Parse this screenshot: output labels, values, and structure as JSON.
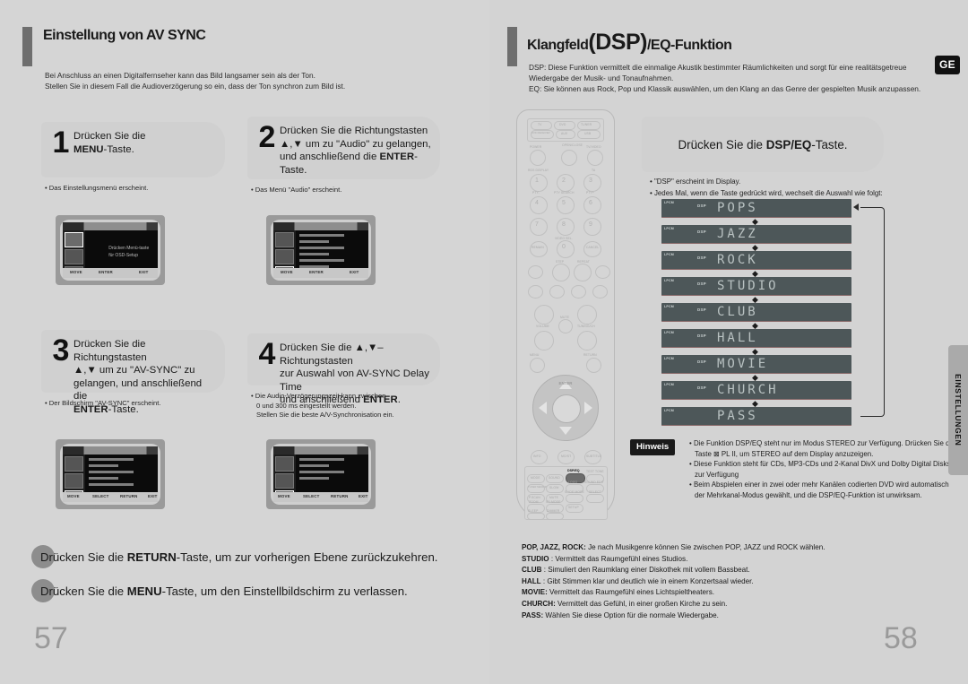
{
  "left_page": {
    "title": "Einstellung von AV SYNC",
    "subtitle_lines": [
      "Bei Anschluss an einen Digitalfernseher kann das Bild langsamer sein als der Ton.",
      "Stellen Sie in diesem Fall die Audioverzögerung so ein, dass der Ton synchron zum Bild ist."
    ],
    "page_number": "57",
    "steps": [
      {
        "number": "1",
        "text_html": "Drücken Sie die<br><b>MENU</b>-Taste.",
        "notes": [
          "Das Einstellungsmenü erscheint."
        ],
        "osd_message": [
          "Drücken Menü-taste",
          "für OSD-Setup"
        ]
      },
      {
        "number": "2",
        "text_html": "Drücken Sie die Richtungstasten<br>▲,▼ um zu \"Audio\" zu gelangen,<br>und anschließend die <b>ENTER</b>-<br>Taste.",
        "notes": [
          "Das Menü \"Audio\" erscheint."
        ],
        "osd_message": []
      },
      {
        "number": "3",
        "text_html": "Drücken Sie die Richtungstasten<br>▲,▼ um zu \"AV-SYNC\" zu<br>gelangen, und anschließend die<br><b>ENTER</b>-Taste.",
        "notes": [
          "Der Bildschirm \"AV-SYNC\" erscheint."
        ],
        "osd_message": []
      },
      {
        "number": "4",
        "text_html": "Drücken Sie die ▲,▼–Richtungstasten<br>zur Auswahl von AV-SYNC Delay Time<br>und anschließend <b>ENTER</b>.",
        "notes": [
          "Die Audio-Verzögerungszeit kann zwischen",
          "0 und 300 ms eingestellt werden.",
          "Stellen Sie die beste A/V-Synchronisation ein."
        ],
        "osd_message": []
      }
    ],
    "osd_footer": [
      "MOVE",
      "ENTER",
      "EXIT"
    ],
    "osd_footer_alt": [
      "MOVE",
      "SELECT",
      "RETURN",
      "EXIT"
    ],
    "hints": [
      "Drücken Sie die <b>RETURN</b>-Taste, um zur vorherigen Ebene zurückzukehren.",
      "Drücken Sie die <b>MENU</b>-Taste, um den Einstellbildschirm zu verlassen."
    ]
  },
  "right_page": {
    "title_main": "Klangfeld",
    "title_paren": "(DSP)",
    "title_rest": "/EQ-Funktion",
    "subtitle_lines": [
      "DSP: Diese Funktion vermittelt die einmalige Akustik bestimmter Räumlichkeiten und sorgt für eine realitätsgetreue",
      "Wiedergabe der Musik- und Tonaufnahmen.",
      "EQ: Sie können aus Rock, Pop und Klassik auswählen, um den Klang an das Genre der gespielten Musik anzupassen."
    ],
    "language_badge": "GE",
    "page_number": "58",
    "side_tab": "EINSTELLUNGEN",
    "press_card_html": "Drücken Sie die <b>DSP/EQ</b>-Taste.",
    "press_notes": [
      "\"DSP\" erscheint im Display.",
      "Jedes Mal, wenn die Taste gedrückt wird, wechselt die Auswahl wie folgt:"
    ],
    "display_panels": [
      {
        "lpcm": "LPCM",
        "tag": "DSP",
        "name": "POPS"
      },
      {
        "lpcm": "LPCM",
        "tag": "DSP",
        "name": "JAZZ"
      },
      {
        "lpcm": "LPCM",
        "tag": "DSP",
        "name": "ROCK"
      },
      {
        "lpcm": "LPCM",
        "tag": "DSP",
        "name": "STUDIO"
      },
      {
        "lpcm": "LPCM",
        "tag": "DSP",
        "name": "CLUB"
      },
      {
        "lpcm": "LPCM",
        "tag": "DSP",
        "name": "HALL"
      },
      {
        "lpcm": "LPCM",
        "tag": "DSP",
        "name": "MOVIE"
      },
      {
        "lpcm": "LPCM",
        "tag": "DSP",
        "name": "CHURCH"
      },
      {
        "lpcm": "LPCM",
        "tag": "",
        "name": "PASS"
      }
    ],
    "note_label": "Hinweis",
    "note_items": [
      "Die Funktion DSP/EQ steht nur im Modus STEREO zur Verfügung. Drücken Sie die Taste ⊠ PL II, um STEREO auf dem Display anzuzeigen.",
      "Diese Funktion steht für CDs, MP3-CDs und 2-Kanal DivX und Dolby Digital Disks zur Verfügung",
      "Beim Abspielen einer in zwei oder mehr Kanälen codierten DVD wird automatisch der Mehrkanal-Modus gewählt, und die DSP/EQ-Funktion ist unwirksam."
    ],
    "glossary": [
      {
        "term": "POP, JAZZ, ROCK:",
        "desc": "Je nach Musikgenre können Sie zwischen POP, JAZZ und ROCK wählen."
      },
      {
        "term": "STUDIO",
        "desc": ": Vermittelt das Raumgefühl eines Studios."
      },
      {
        "term": "CLUB",
        "desc": ": Simuliert den Raumklang einer Diskothek mit vollem Bassbeat."
      },
      {
        "term": "HALL",
        "desc": ": Gibt Stimmen klar und deutlich wie in einem Konzertsaal wieder."
      },
      {
        "term": "MOVIE:",
        "desc": "Vermittelt das Raumgefühl eines Lichtspieltheaters."
      },
      {
        "term": "CHURCH:",
        "desc": "Vermittelt das Gefühl, in einer großen Kirche zu sein."
      },
      {
        "term": "PASS:",
        "desc": "Wählen Sie diese Option für die normale Wiedergabe."
      }
    ]
  },
  "remote": {
    "source_buttons": [
      "TV",
      "DVD",
      "TUNER",
      "DVD RECEIVER",
      "AUX",
      "USB"
    ],
    "top_labels": {
      "power": "POWER",
      "open_close": "OPEN/CLOSE",
      "tv_video": "TV/VIDEO"
    },
    "numeric_labels": [
      "1",
      "2",
      "3",
      "4",
      "5",
      "6",
      "7",
      "8",
      "9",
      "0"
    ],
    "function_labels": [
      "RDS DISPLAY",
      "TA",
      "PTY-",
      "PTY SEARCH",
      "PTY+",
      "REMAIN",
      "VIDEO SEL.",
      "CANCEL",
      "STEP",
      "REPEAT"
    ],
    "mid_labels": [
      "VOLUME",
      "MUTE",
      "MENU",
      "RETURN",
      "ENTER",
      "TUNING/CH",
      "INFO",
      "MO/ST",
      "SUBTITLE"
    ],
    "bottom_labels": [
      "MODE",
      "SOUND",
      "TUNER MEMORY",
      "SLOW",
      "P.SCAN",
      "MUTE",
      "ZOOM",
      "SD MODE",
      "SLIDE MODE",
      "SELECT",
      "SETUP",
      "SLEEP",
      "DIMMER",
      "DSP/EQ",
      "TEST TONE",
      "LOGO",
      "SOUND EDIT"
    ],
    "highlighted_button": "DSP/EQ"
  }
}
